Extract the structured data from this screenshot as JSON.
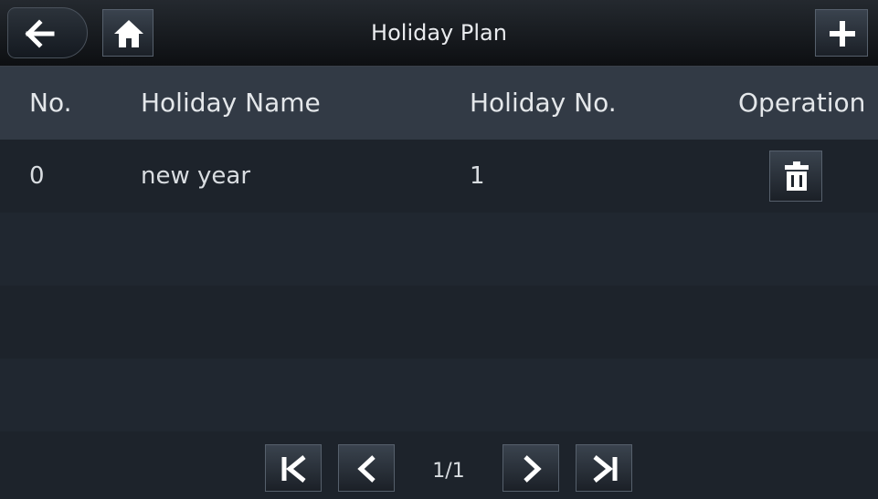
{
  "header": {
    "title": "Holiday Plan",
    "back_icon": "arrow-left-icon",
    "home_icon": "home-icon",
    "add_icon": "plus-icon"
  },
  "table": {
    "columns": [
      "No.",
      "Holiday Name",
      "Holiday No.",
      "Operation"
    ],
    "rows": [
      {
        "no": "0",
        "name": "new year",
        "holiday_no": "1",
        "operation_icon": "trash-icon"
      }
    ]
  },
  "pagination": {
    "page": "1/1",
    "first_icon": "first-page-icon",
    "prev_icon": "chevron-left-icon",
    "next_icon": "chevron-right-icon",
    "last_icon": "last-page-icon"
  },
  "colors": {
    "background": "#1d232b",
    "header_row": "#323a45",
    "text": "#e6e8ea"
  }
}
